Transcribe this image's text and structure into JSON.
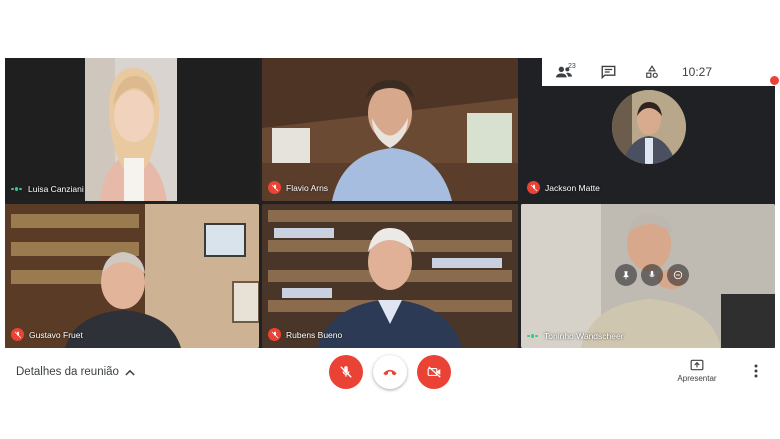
{
  "participants": [
    {
      "name": "Luisa Canziani",
      "mic": "speaking"
    },
    {
      "name": "Flavio Arns",
      "mic": "muted"
    },
    {
      "name": "Jackson Matte",
      "mic": "muted"
    },
    {
      "name": "Gustavo Fruet",
      "mic": "muted"
    },
    {
      "name": "Rubens Bueno",
      "mic": "muted"
    },
    {
      "name": "Toninho Wandscheer",
      "mic": "speaking"
    }
  ],
  "top_panel": {
    "people_count": "23",
    "time": "10:27"
  },
  "bottom_bar": {
    "meeting_details": "Detalhes da reunião",
    "present_label": "Apresentar"
  },
  "colors": {
    "accent_red": "#ea4335",
    "dark_bg": "#202124",
    "speaking_green": "#34c98e"
  },
  "icons": [
    "people-icon",
    "chat-icon",
    "activities-icon",
    "mic-off-icon",
    "hangup-icon",
    "camera-off-icon",
    "present-icon",
    "more-vert-icon",
    "chevron-up-icon"
  ]
}
